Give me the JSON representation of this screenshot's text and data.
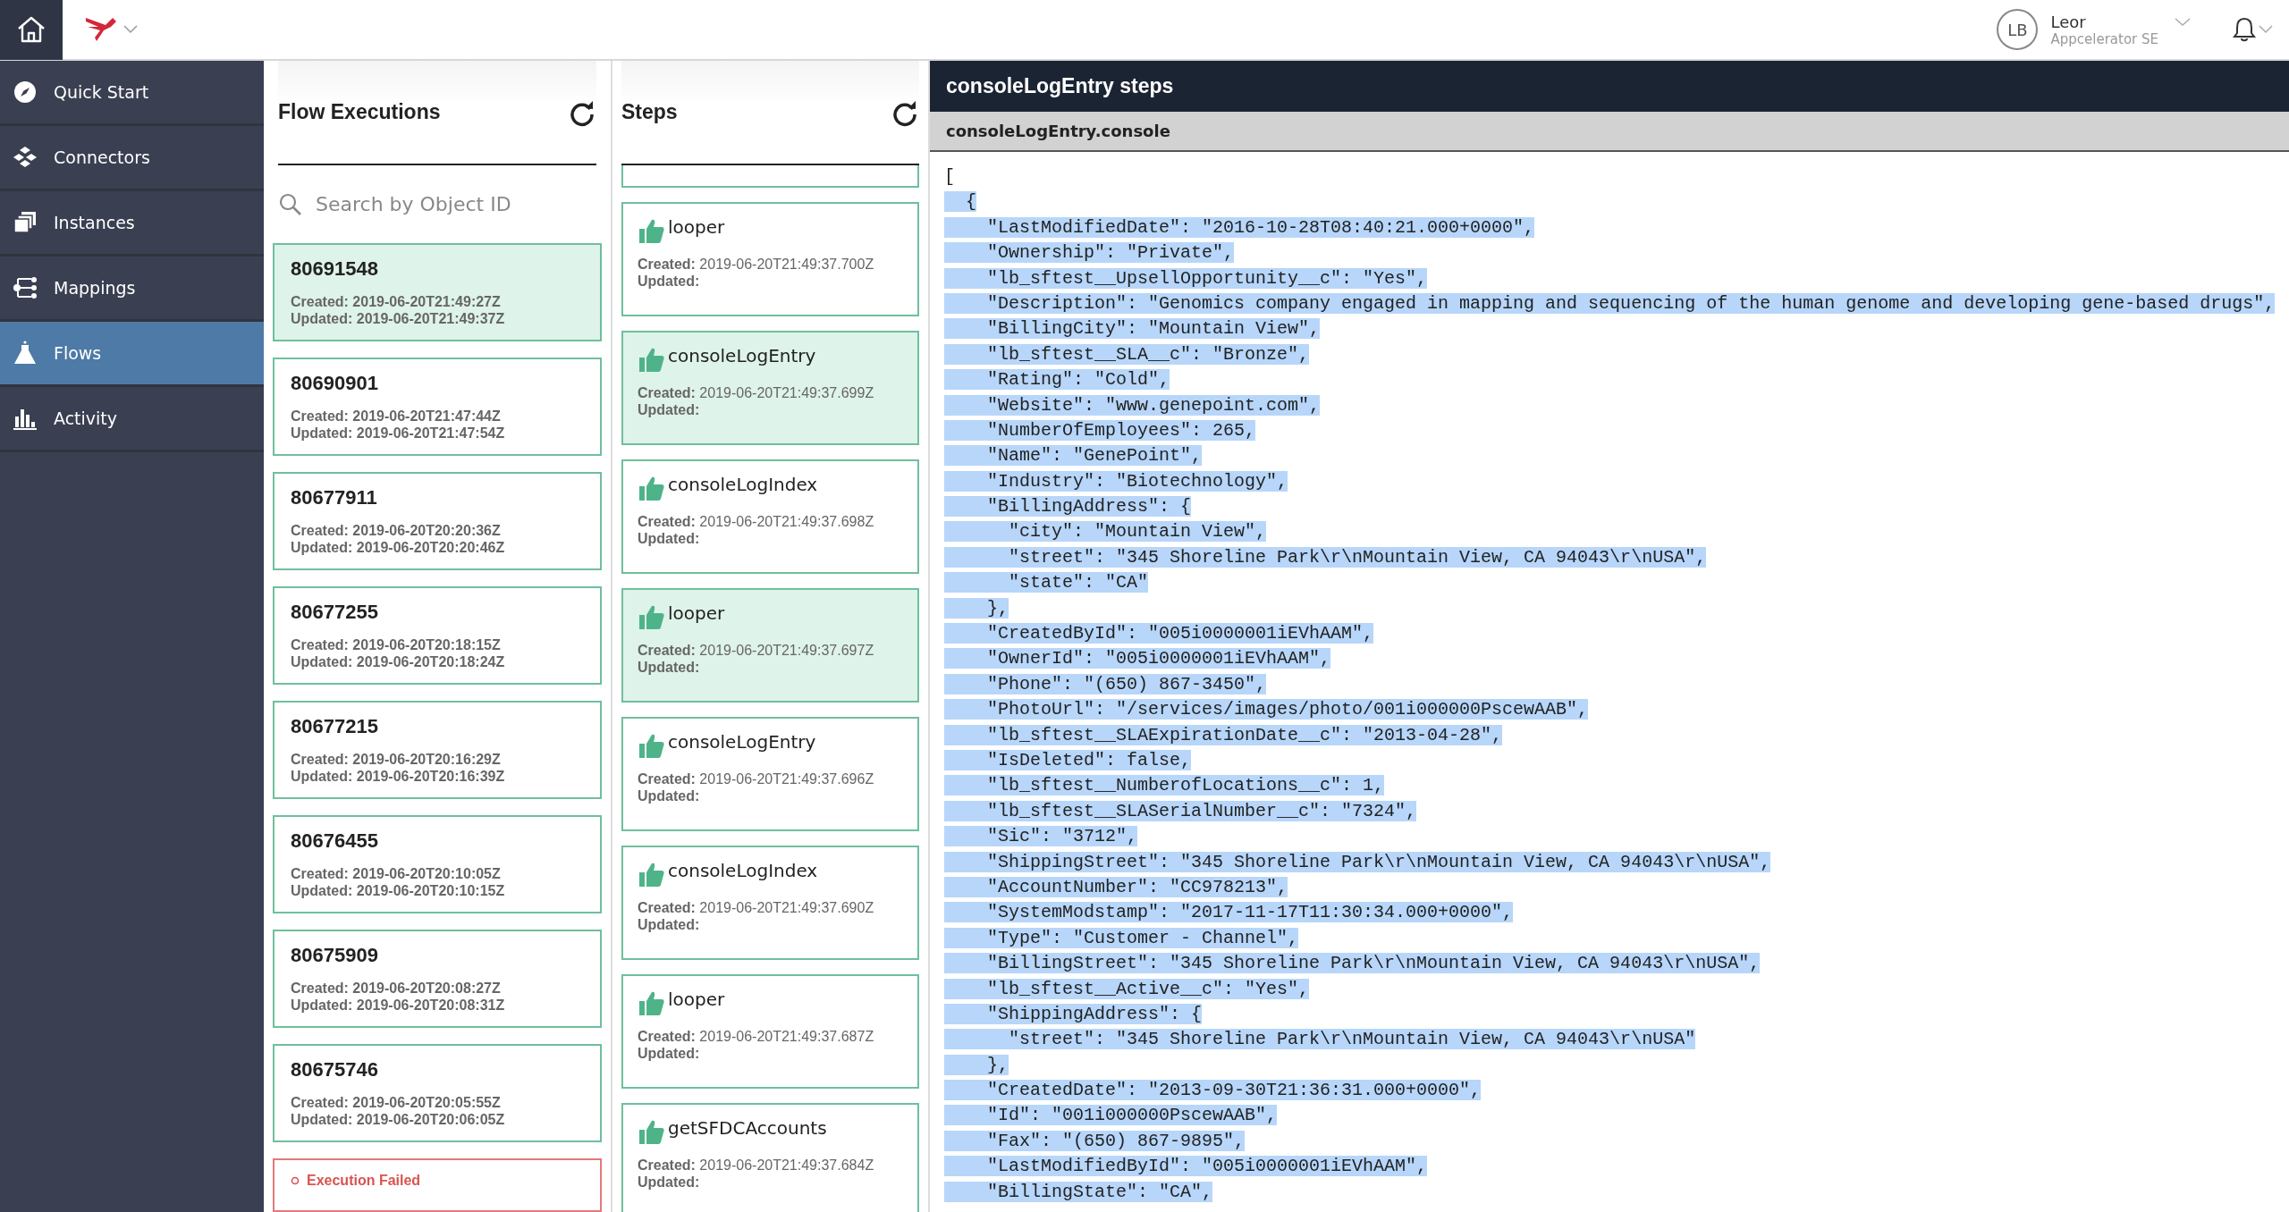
{
  "top_bar": {
    "user": {
      "initials": "LB",
      "name": "Leor",
      "org": "Appcelerator SE"
    }
  },
  "sidebar": {
    "items": [
      {
        "label": "Quick Start",
        "selected": false
      },
      {
        "label": "Connectors",
        "selected": false
      },
      {
        "label": "Instances",
        "selected": false
      },
      {
        "label": "Mappings",
        "selected": false
      },
      {
        "label": "Flows",
        "selected": true
      },
      {
        "label": "Activity",
        "selected": false
      }
    ]
  },
  "flow_executions": {
    "title": "Flow Executions",
    "search": {
      "placeholder": "Search by Object ID"
    },
    "items": [
      {
        "kind": "execution",
        "id": "80691548",
        "created": "Created: 2019-06-20T21:49:27Z",
        "updated": "Updated: 2019-06-20T21:49:37Z",
        "selected": true
      },
      {
        "kind": "execution",
        "id": "80690901",
        "created": "Created: 2019-06-20T21:47:44Z",
        "updated": "Updated: 2019-06-20T21:47:54Z",
        "selected": false
      },
      {
        "kind": "execution",
        "id": "80677911",
        "created": "Created: 2019-06-20T20:20:36Z",
        "updated": "Updated: 2019-06-20T20:20:46Z",
        "selected": false
      },
      {
        "kind": "execution",
        "id": "80677255",
        "created": "Created: 2019-06-20T20:18:15Z",
        "updated": "Updated: 2019-06-20T20:18:24Z",
        "selected": false
      },
      {
        "kind": "execution",
        "id": "80677215",
        "created": "Created: 2019-06-20T20:16:29Z",
        "updated": "Updated: 2019-06-20T20:16:39Z",
        "selected": false
      },
      {
        "kind": "execution",
        "id": "80676455",
        "created": "Created: 2019-06-20T20:10:05Z",
        "updated": "Updated: 2019-06-20T20:10:15Z",
        "selected": false
      },
      {
        "kind": "execution",
        "id": "80675909",
        "created": "Created: 2019-06-20T20:08:27Z",
        "updated": "Updated: 2019-06-20T20:08:31Z",
        "selected": false
      },
      {
        "kind": "execution",
        "id": "80675746",
        "created": "Created: 2019-06-20T20:05:55Z",
        "updated": "Updated: 2019-06-20T20:06:05Z",
        "selected": false
      },
      {
        "kind": "failed",
        "status": "Execution Failed",
        "selected": false
      }
    ]
  },
  "steps": {
    "title": "Steps",
    "items": [
      {
        "name": "looper",
        "created": "**Created:** 2019-06-20T21:49:37.700Z",
        "updated": "Updated:",
        "selected": false
      },
      {
        "name": "consoleLogEntry",
        "created": "**Created:** 2019-06-20T21:49:37.699Z",
        "updated": "Updated:",
        "selected": true
      },
      {
        "name": "consoleLogIndex",
        "created": "**Created:** 2019-06-20T21:49:37.698Z",
        "updated": "Updated:",
        "selected": false
      },
      {
        "name": "looper",
        "created": "**Created:** 2019-06-20T21:49:37.697Z",
        "updated": "Updated:",
        "selected": true
      },
      {
        "name": "consoleLogEntry",
        "created": "**Created:** 2019-06-20T21:49:37.696Z",
        "updated": "Updated:",
        "selected": false
      },
      {
        "name": "consoleLogIndex",
        "created": "**Created:** 2019-06-20T21:49:37.690Z",
        "updated": "Updated:",
        "selected": false
      },
      {
        "name": "looper",
        "created": "**Created:** 2019-06-20T21:49:37.687Z",
        "updated": "Updated:",
        "selected": false
      },
      {
        "name": "getSFDCAccounts",
        "created": "**Created:** 2019-06-20T21:49:37.684Z",
        "updated": "Updated:",
        "selected": false
      }
    ]
  },
  "detail": {
    "title": "consoleLogEntry steps",
    "subtitle": "consoleLogEntry.console",
    "lines": [
      {
        "text": "[",
        "selected": false
      },
      {
        "text": "  {",
        "selected": true
      },
      {
        "text": "    \"LastModifiedDate\": \"2016-10-28T08:40:21.000+0000\",",
        "selected": true
      },
      {
        "text": "    \"Ownership\": \"Private\",",
        "selected": true
      },
      {
        "text": "    \"lb_sftest__UpsellOpportunity__c\": \"Yes\",",
        "selected": true
      },
      {
        "text": "    \"Description\": \"Genomics company engaged in mapping and sequencing of the human genome and developing gene-based drugs\",",
        "selected": true
      },
      {
        "text": "    \"BillingCity\": \"Mountain View\",",
        "selected": true
      },
      {
        "text": "    \"lb_sftest__SLA__c\": \"Bronze\",",
        "selected": true
      },
      {
        "text": "    \"Rating\": \"Cold\",",
        "selected": true
      },
      {
        "text": "    \"Website\": \"www.genepoint.com\",",
        "selected": true
      },
      {
        "text": "    \"NumberOfEmployees\": 265,",
        "selected": true
      },
      {
        "text": "    \"Name\": \"GenePoint\",",
        "selected": true
      },
      {
        "text": "    \"Industry\": \"Biotechnology\",",
        "selected": true
      },
      {
        "text": "    \"BillingAddress\": {",
        "selected": true
      },
      {
        "text": "      \"city\": \"Mountain View\",",
        "selected": true
      },
      {
        "text": "      \"street\": \"345 Shoreline Park\\r\\nMountain View, CA 94043\\r\\nUSA\",",
        "selected": true
      },
      {
        "text": "      \"state\": \"CA\"",
        "selected": true
      },
      {
        "text": "    },",
        "selected": true
      },
      {
        "text": "    \"CreatedById\": \"005i0000001iEVhAAM\",",
        "selected": true
      },
      {
        "text": "    \"OwnerId\": \"005i0000001iEVhAAM\",",
        "selected": true
      },
      {
        "text": "    \"Phone\": \"(650) 867-3450\",",
        "selected": true
      },
      {
        "text": "    \"PhotoUrl\": \"/services/images/photo/001i000000PscewAAB\",",
        "selected": true
      },
      {
        "text": "    \"lb_sftest__SLAExpirationDate__c\": \"2013-04-28\",",
        "selected": true
      },
      {
        "text": "    \"IsDeleted\": false,",
        "selected": true
      },
      {
        "text": "    \"lb_sftest__NumberofLocations__c\": 1,",
        "selected": true
      },
      {
        "text": "    \"lb_sftest__SLASerialNumber__c\": \"7324\",",
        "selected": true
      },
      {
        "text": "    \"Sic\": \"3712\",",
        "selected": true
      },
      {
        "text": "    \"ShippingStreet\": \"345 Shoreline Park\\r\\nMountain View, CA 94043\\r\\nUSA\",",
        "selected": true
      },
      {
        "text": "    \"AccountNumber\": \"CC978213\",",
        "selected": true
      },
      {
        "text": "    \"SystemModstamp\": \"2017-11-17T11:30:34.000+0000\",",
        "selected": true
      },
      {
        "text": "    \"Type\": \"Customer - Channel\",",
        "selected": true
      },
      {
        "text": "    \"BillingStreet\": \"345 Shoreline Park\\r\\nMountain View, CA 94043\\r\\nUSA\",",
        "selected": true
      },
      {
        "text": "    \"lb_sftest__Active__c\": \"Yes\",",
        "selected": true
      },
      {
        "text": "    \"ShippingAddress\": {",
        "selected": true
      },
      {
        "text": "      \"street\": \"345 Shoreline Park\\r\\nMountain View, CA 94043\\r\\nUSA\"",
        "selected": true
      },
      {
        "text": "    },",
        "selected": true
      },
      {
        "text": "    \"CreatedDate\": \"2013-09-30T21:36:31.000+0000\",",
        "selected": true
      },
      {
        "text": "    \"Id\": \"001i000000PscewAAB\",",
        "selected": true
      },
      {
        "text": "    \"Fax\": \"(650) 867-9895\",",
        "selected": true
      },
      {
        "text": "    \"LastModifiedById\": \"005i0000001iEVhAAM\",",
        "selected": true
      },
      {
        "text": "    \"BillingState\": \"CA\",",
        "selected": true
      }
    ]
  }
}
